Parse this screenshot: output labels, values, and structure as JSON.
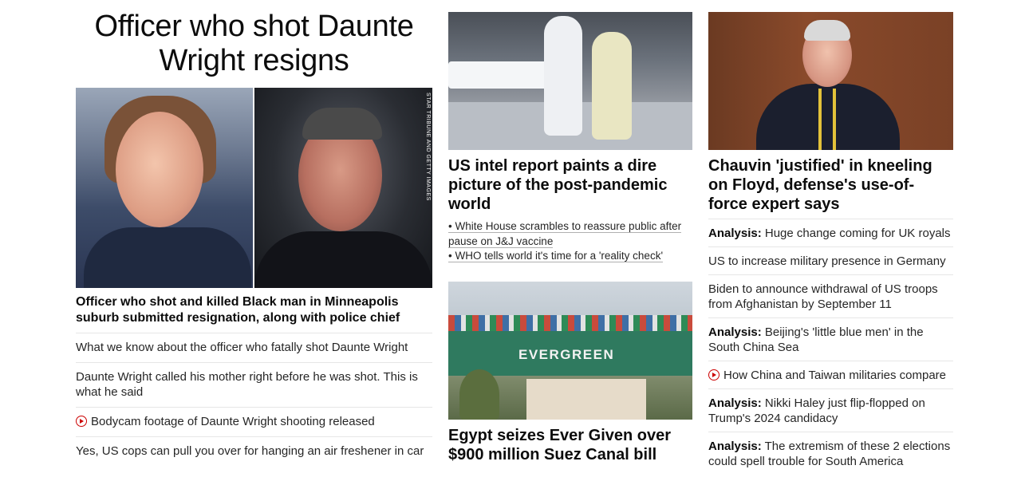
{
  "banner": {
    "headline": "Officer who shot Daunte Wright resigns"
  },
  "lead": {
    "photo_credit": "STAR TRIBUNE AND GETTY IMAGES",
    "headline": "Officer who shot and killed Black man in Minneapolis suburb submitted resignation, along with police chief",
    "related": [
      {
        "text": "What we know about the officer who fatally shot Daunte Wright"
      },
      {
        "text": "Daunte Wright called his mother right before he was shot. This is what he said"
      },
      {
        "text": "Bodycam footage of Daunte Wright shooting released",
        "icon": "play-video-icon"
      },
      {
        "text": "Yes, US cops can pull you over for hanging an air freshener in car"
      }
    ]
  },
  "pandemic": {
    "headline": "US intel report paints a dire picture of the post-pandemic world",
    "related": [
      "• White House scrambles to reassure public after pause on J&J vaccine",
      "• WHO tells world it's time for a 'reality check'"
    ]
  },
  "egypt": {
    "ship_name": "EVERGREEN",
    "headline": "Egypt seizes Ever Given over $900 million Suez Canal bill"
  },
  "chauvin": {
    "headline": "Chauvin 'justified' in kneeling on Floyd, defense's use-of-force expert says",
    "list": [
      {
        "kicker": "Analysis:",
        "text": " Huge change coming for UK royals"
      },
      {
        "kicker": "",
        "text": "US to increase military presence in Germany"
      },
      {
        "kicker": "",
        "text": "Biden to announce withdrawal of US troops from Afghanistan by September 11"
      },
      {
        "kicker": "Analysis:",
        "text": " Beijing's 'little blue men' in the South China Sea"
      },
      {
        "kicker": "",
        "text": "How China and Taiwan militaries compare",
        "icon": "play-video-icon"
      },
      {
        "kicker": "Analysis:",
        "text": " Nikki Haley just flip-flopped on Trump's 2024 candidacy"
      },
      {
        "kicker": "Analysis:",
        "text": " The extremism of these 2 elections could spell trouble for South America"
      }
    ]
  },
  "colors": {
    "accent": "#cc0000",
    "text": "#262626",
    "divider": "#e6e6e6"
  }
}
